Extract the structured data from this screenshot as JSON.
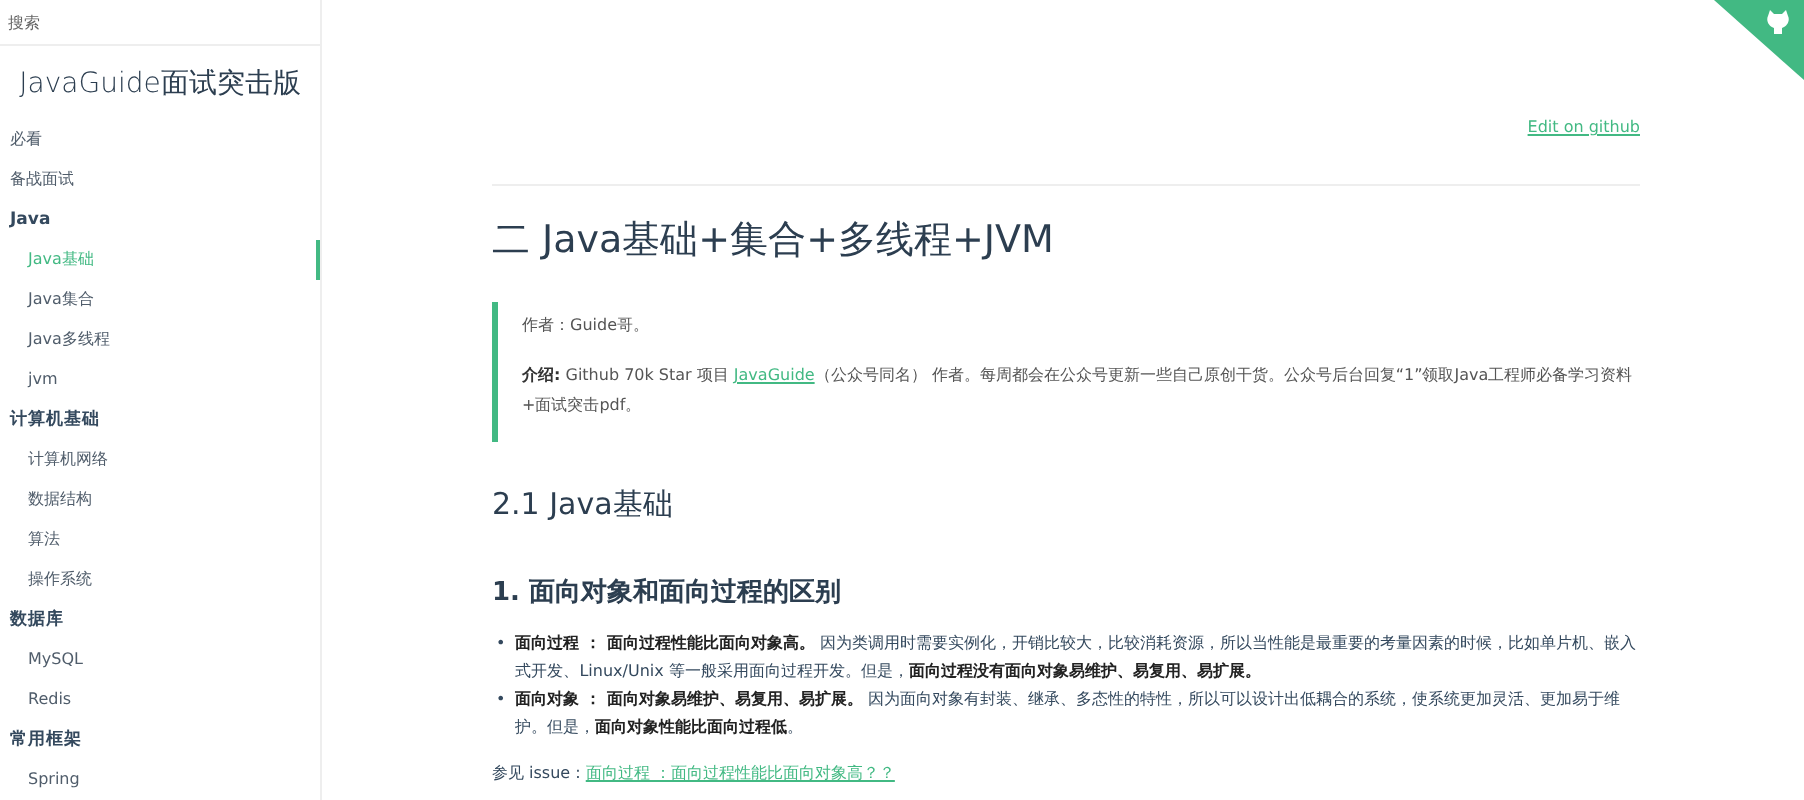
{
  "sidebar": {
    "search": {
      "placeholder": "搜索"
    },
    "title": "JavaGuide面试突击版",
    "items": [
      {
        "label": "必看",
        "selected": false
      },
      {
        "label": "备战面试",
        "selected": false
      },
      {
        "label": "Java",
        "selected": false,
        "children": [
          {
            "label": "Java基础",
            "selected": true
          },
          {
            "label": "Java集合",
            "selected": false
          },
          {
            "label": "Java多线程",
            "selected": false
          },
          {
            "label": "jvm",
            "selected": false
          }
        ]
      },
      {
        "label": "计算机基础",
        "selected": false,
        "children": [
          {
            "label": "计算机网络",
            "selected": false
          },
          {
            "label": "数据结构",
            "selected": false
          },
          {
            "label": "算法",
            "selected": false
          },
          {
            "label": "操作系统",
            "selected": false
          }
        ]
      },
      {
        "label": "数据库",
        "selected": false,
        "children": [
          {
            "label": "MySQL",
            "selected": false
          },
          {
            "label": "Redis",
            "selected": false
          }
        ]
      },
      {
        "label": "常用框架",
        "selected": false,
        "children": [
          {
            "label": "Spring",
            "selected": false
          }
        ]
      }
    ]
  },
  "edit_link": "Edit on github",
  "article": {
    "title": "二 Java基础+集合+多线程+JVM",
    "quote": {
      "author": "作者：Guide哥。",
      "intro_label": "介绍:",
      "intro_before": "Github 70k Star 项目 ",
      "intro_link": "JavaGuide",
      "intro_after": "（公众号同名） 作者。每周都会在公众号更新一些自己原创干货。公众号后台回复“1”领取Java工程师必备学习资料+面试突击pdf。"
    },
    "section": "2.1 Java基础",
    "subsection": "1. 面向对象和面向过程的区别",
    "bullets": [
      {
        "marker": "•",
        "text": "**面向过程 ： 面向过程性能比面向对象高。** 因为类调用时需要实例化，开销比较大，比较消耗资源，所以当性能是最重要的考量因素的时候，比如单片机、嵌入式开发、Linux/Unix 等一般采用面向过程开发。但是，**面向过程没有面向对象易维护、易复用、易扩展。**"
      },
      {
        "marker": "•",
        "text": "**面向对象 ： 面向对象易维护、易复用、易扩展。** 因为面向对象有封装、继承、多态性的特性，所以可以设计出低耦合的系统，使系统更加灵活、更加易于维护。但是，**面向对象性能比面向过程低**。"
      }
    ],
    "see_also": {
      "prefix": "参见 issue : ",
      "link": "面向过程 ：面向过程性能比面向对象高？？"
    }
  }
}
